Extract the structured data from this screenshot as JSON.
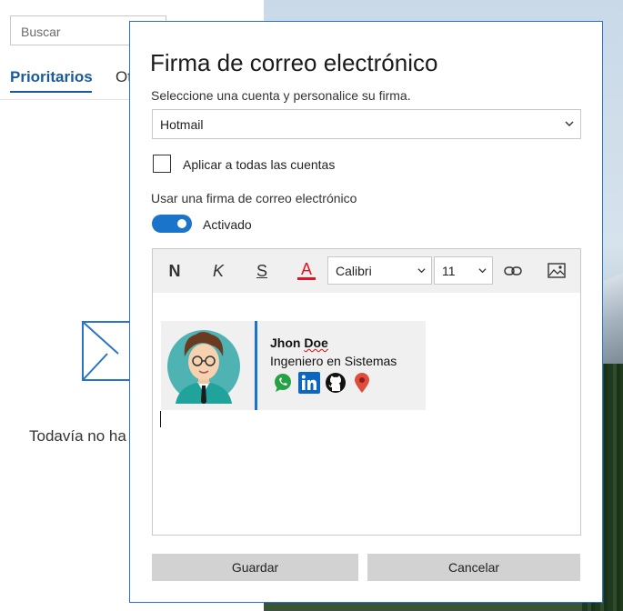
{
  "background": {
    "search_placeholder": "Buscar",
    "tabs": [
      {
        "label": "Prioritarios",
        "active": true
      },
      {
        "label": "Ot",
        "active": false
      }
    ],
    "empty_message": "Todavía no ha",
    "colors": {
      "accent": "#1a5a9b"
    }
  },
  "dialog": {
    "title": "Firma de correo electrónico",
    "subtitle": "Seleccione una cuenta y personalice su firma.",
    "account_select": {
      "value": "Hotmail"
    },
    "apply_all": {
      "label": "Aplicar a todas las cuentas",
      "checked": false
    },
    "use_signature_label": "Usar una firma de correo electrónico",
    "toggle": {
      "label": "Activado",
      "on": true
    },
    "toolbar": {
      "bold": "N",
      "italic": "K",
      "strike": "S",
      "font_color": "A",
      "font": "Calibri",
      "size": "11",
      "icons": [
        "link-icon",
        "image-icon",
        "chevron-down-icon"
      ]
    },
    "signature": {
      "name_first": "Jhon",
      "name_last": "Doe",
      "role": "Ingeniero en Sistemas",
      "icons": [
        "whatsapp-icon",
        "linkedin-icon",
        "github-icon",
        "location-pin-icon"
      ]
    },
    "buttons": {
      "save": "Guardar",
      "cancel": "Cancelar"
    },
    "colors": {
      "accent": "#1a74c9",
      "border": "#2b74c5",
      "font_color_bar": "#e81123"
    }
  }
}
